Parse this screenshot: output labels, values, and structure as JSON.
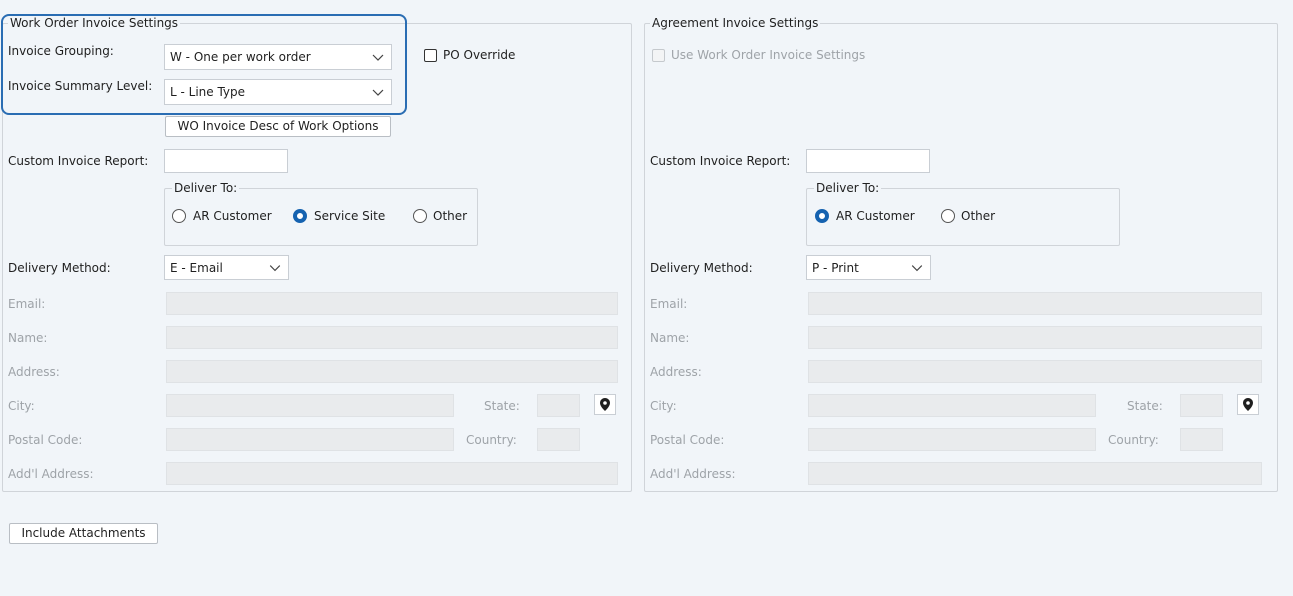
{
  "wo": {
    "legend": "Work Order Invoice Settings",
    "invoice_grouping_label": "Invoice Grouping:",
    "invoice_grouping_value": "W - One per work order",
    "po_override_label": "PO Override",
    "invoice_summary_label": "Invoice Summary Level:",
    "invoice_summary_value": "L - Line Type",
    "desc_options_button": "WO Invoice Desc of Work Options",
    "custom_report_label": "Custom Invoice Report:",
    "deliver_to_legend": "Deliver To:",
    "deliver_to_options": [
      "AR Customer",
      "Service Site",
      "Other"
    ],
    "deliver_to_selected": "Service Site",
    "delivery_method_label": "Delivery Method:",
    "delivery_method_value": "E - Email",
    "email_label": "Email:",
    "name_label": "Name:",
    "address_label": "Address:",
    "city_label": "City:",
    "state_label": "State:",
    "postal_label": "Postal Code:",
    "country_label": "Country:",
    "addl_label": "Add'l Address:"
  },
  "agreement": {
    "legend": "Agreement Invoice Settings",
    "use_wo_label": "Use Work Order Invoice Settings",
    "custom_report_label": "Custom Invoice Report:",
    "deliver_to_legend": "Deliver To:",
    "deliver_to_options": [
      "AR Customer",
      "Other"
    ],
    "deliver_to_selected": "AR Customer",
    "delivery_method_label": "Delivery Method:",
    "delivery_method_value": "P - Print",
    "email_label": "Email:",
    "name_label": "Name:",
    "address_label": "Address:",
    "city_label": "City:",
    "state_label": "State:",
    "postal_label": "Postal Code:",
    "country_label": "Country:",
    "addl_label": "Add'l Address:"
  },
  "include_attachments_button": "Include Attachments",
  "icons": {
    "chevron": "chevron-down-icon",
    "pin": "map-pin-icon"
  },
  "colors": {
    "accent": "#1562b0",
    "highlight": "#2a6db3",
    "background": "#f1f5f9"
  }
}
